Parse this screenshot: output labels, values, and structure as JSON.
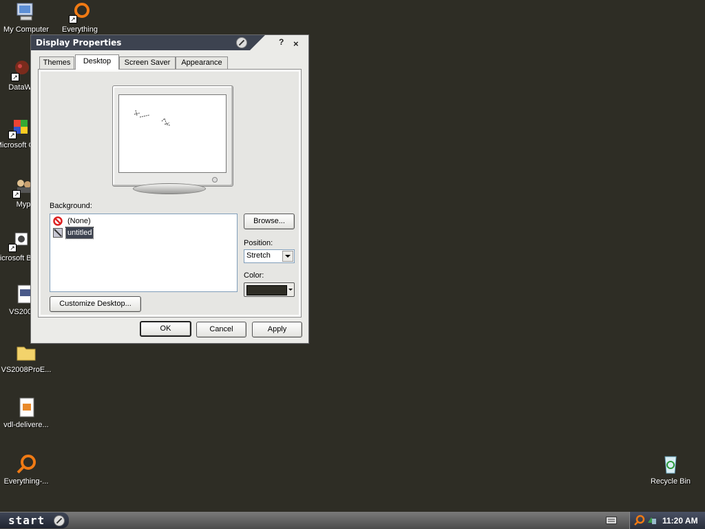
{
  "desktop": {
    "icons": [
      {
        "label": "My Computer"
      },
      {
        "label": "Everything"
      },
      {
        "label": "DataWa"
      },
      {
        "label": "Microsoft C++"
      },
      {
        "label": "Myp"
      },
      {
        "label": "Microsoft Basic"
      },
      {
        "label": "VS2008F"
      },
      {
        "label": "VS2008ProE..."
      },
      {
        "label": "vdl-delivere..."
      },
      {
        "label": "Everything-..."
      },
      {
        "label": "Recycle Bin"
      }
    ],
    "background_color": "#2e2d25"
  },
  "window": {
    "title": "Display Properties",
    "help_label": "?",
    "close_label": "×",
    "tabs": [
      {
        "label": "Themes"
      },
      {
        "label": "Desktop"
      },
      {
        "label": "Screen Saver"
      },
      {
        "label": "Appearance"
      }
    ],
    "active_tab": "Desktop",
    "background_label": "Background:",
    "background_items": [
      {
        "label": "(None)",
        "icon": "none-icon"
      },
      {
        "label": "untitled",
        "icon": "image-icon",
        "selected": true
      }
    ],
    "browse_label": "Browse...",
    "position_label": "Position:",
    "position_value": "Stretch",
    "color_label": "Color:",
    "color_value": "#2e2d25",
    "customize_label": "Customize Desktop...",
    "ok_label": "OK",
    "cancel_label": "Cancel",
    "apply_label": "Apply"
  },
  "taskbar": {
    "start_label": "start",
    "clock": "11:20 AM"
  }
}
